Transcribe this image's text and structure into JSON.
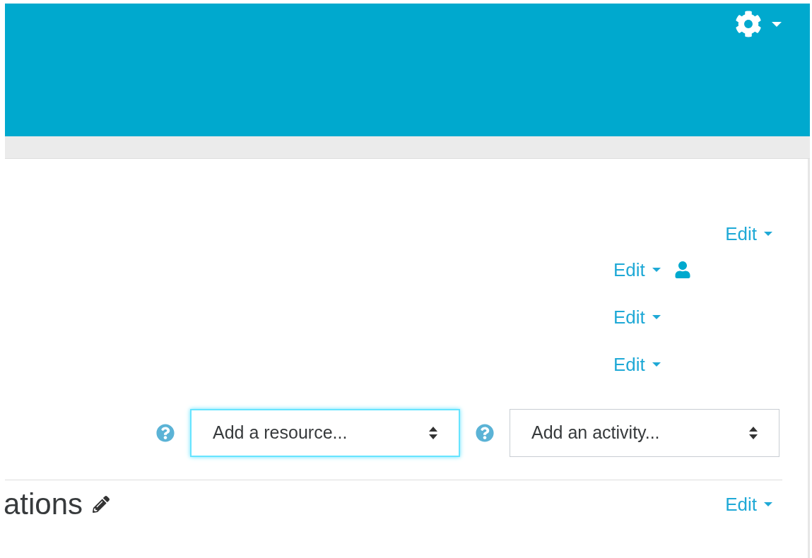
{
  "section_menu": {
    "label": "Edit"
  },
  "activities": [
    {
      "label": "Edit",
      "restricted": true
    },
    {
      "label": "Edit",
      "restricted": false
    },
    {
      "label": "Edit",
      "restricted": false
    }
  ],
  "chooser": [
    {
      "placeholder": "Add a resource...",
      "focused": true
    },
    {
      "placeholder": "Add an activity...",
      "focused": false
    }
  ],
  "next_section": {
    "title": "ations",
    "menu_label": "Edit"
  }
}
